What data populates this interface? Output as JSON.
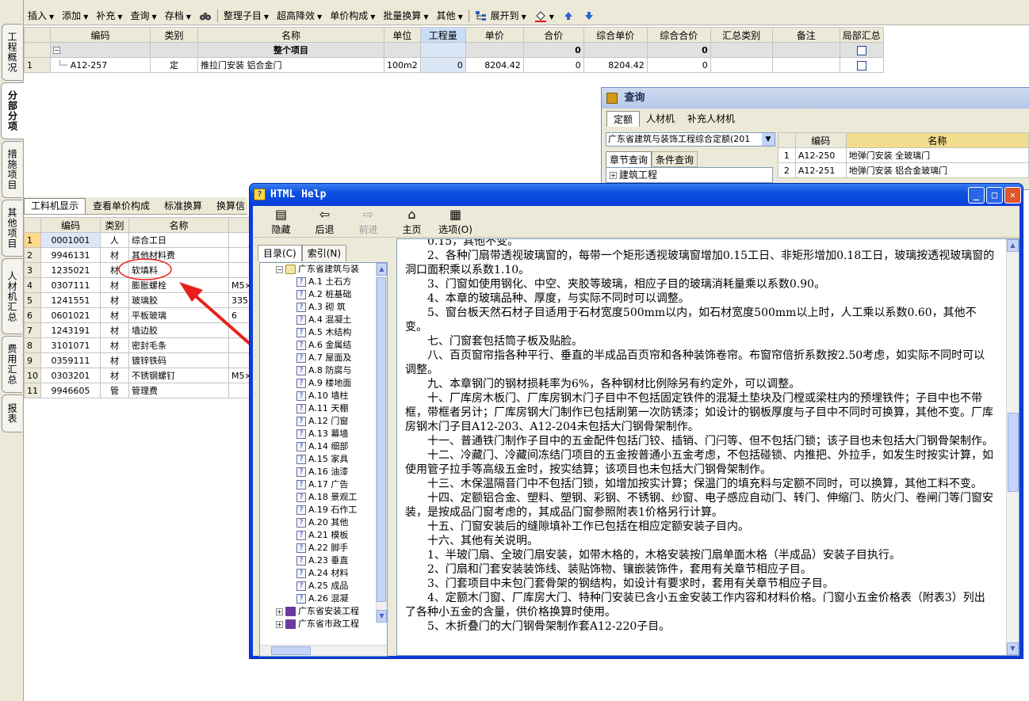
{
  "side_tabs": [
    {
      "label": "工程概况",
      "active": false
    },
    {
      "label": "分部分项",
      "active": true
    },
    {
      "label": "措施项目",
      "active": false
    },
    {
      "label": "其他项目",
      "active": false
    },
    {
      "label": "人材机汇总",
      "active": false
    },
    {
      "label": "费用汇总",
      "active": false
    },
    {
      "label": "报表",
      "active": false
    }
  ],
  "toolbar": {
    "insert": "插入",
    "add": "添加",
    "supplement": "补充",
    "query": "查询",
    "archive": "存档",
    "organize": "整理子目",
    "superheight": "超高降效",
    "unit_price": "单价构成",
    "batch": "批量换算",
    "other": "其他",
    "expand": "展开到"
  },
  "main_table": {
    "headers": [
      "编码",
      "类别",
      "名称",
      "单位",
      "工程量",
      "单价",
      "合价",
      "综合单价",
      "综合合价",
      "汇总类别",
      "备注",
      "局部汇总"
    ],
    "total_row": {
      "name": "整个项目",
      "hejia": "0",
      "zonghe_hejia": "0"
    },
    "rows": [
      {
        "num": "1",
        "code": "A12-257",
        "type": "定",
        "name": "推拉门安装 铝合金门",
        "unit": "100m2",
        "qty": "0",
        "price": "8204.42",
        "hejia": "0",
        "zonghe_price": "8204.42",
        "zonghe_hejia": "0"
      }
    ]
  },
  "lower_tabs": [
    "工料机显示",
    "查看单价构成",
    "标准换算",
    "换算信"
  ],
  "materials": {
    "headers": [
      "编码",
      "类别",
      "名称"
    ],
    "rows": [
      {
        "num": "1",
        "code": "0001001",
        "type": "人",
        "name": "综合工日",
        "extra": ""
      },
      {
        "num": "2",
        "code": "9946131",
        "type": "材",
        "name": "其他材料费",
        "extra": ""
      },
      {
        "num": "3",
        "code": "1235021",
        "type": "材",
        "name": "软填料",
        "extra": ""
      },
      {
        "num": "4",
        "code": "0307111",
        "type": "材",
        "name": "膨胀螺栓",
        "extra": "M5×"
      },
      {
        "num": "5",
        "code": "1241551",
        "type": "材",
        "name": "玻璃胶",
        "extra": "335"
      },
      {
        "num": "6",
        "code": "0601021",
        "type": "材",
        "name": "平板玻璃",
        "extra": "6"
      },
      {
        "num": "7",
        "code": "1243191",
        "type": "材",
        "name": "墙边胶",
        "extra": ""
      },
      {
        "num": "8",
        "code": "3101071",
        "type": "材",
        "name": "密封毛条",
        "extra": ""
      },
      {
        "num": "9",
        "code": "0359111",
        "type": "材",
        "name": "镀锌铁码",
        "extra": ""
      },
      {
        "num": "10",
        "code": "0303201",
        "type": "材",
        "name": "不锈钢螺钉",
        "extra": "M5×"
      },
      {
        "num": "11",
        "code": "9946605",
        "type": "管",
        "name": "管理费",
        "extra": ""
      }
    ]
  },
  "query_window": {
    "title": "查询",
    "tabs": [
      "定额",
      "人材机",
      "补充人材机"
    ],
    "select": "广东省建筑与装饰工程综合定额(201",
    "subtabs": [
      "章节查询",
      "条件查询"
    ],
    "tree_item": "建筑工程",
    "headers": [
      "编码",
      "名称"
    ],
    "rows": [
      {
        "num": "1",
        "code": "A12-250",
        "name": "地弹门安装 全玻璃门"
      },
      {
        "num": "2",
        "code": "A12-251",
        "name": "地弹门安装 铝合金玻璃门"
      }
    ]
  },
  "help_window": {
    "title": "HTML Help",
    "buttons": {
      "hide": "隐藏",
      "back": "后退",
      "forward": "前进",
      "home": "主页",
      "options": "选项(O)"
    },
    "nav_tabs": [
      "目录(C)",
      "索引(N)"
    ],
    "tree_root": "广东省建筑与装",
    "tree_items": [
      "A.1 土石方",
      "A.2 桩基础",
      "A.3 砌 筑",
      "A.4 混凝土",
      "A.5 木结构",
      "A.6 金属结",
      "A.7 屋面及",
      "A.8 防腐与",
      "A.9 楼地面",
      "A.10 墙柱",
      "A.11 天棚",
      "A.12 门窗",
      "A.13 幕墙",
      "A.14 细部",
      "A.15 家具",
      "A.16 油漆",
      "A.17 广告",
      "A.18 景观工",
      "A.19 石作工",
      "A.20 其他",
      "A.21 模板",
      "A.22 脚手",
      "A.23 垂直",
      "A.24 材料",
      "A.25 成品",
      "A.26 混凝"
    ],
    "tree_bottom": [
      "广东省安装工程",
      "广东省市政工程"
    ],
    "paragraphs": [
      "0.15，其他不变。",
      "2、各种门扇带透视玻璃窗的，每带一个矩形透视玻璃窗增加0.15工日、非矩形增加0.18工日，玻璃按透视玻璃窗的洞口面积乘以系数1.10。",
      "3、门窗如使用钢化、中空、夹胶等玻璃，相应子目的玻璃消耗量乘以系数0.90。",
      "4、本章的玻璃品种、厚度，与实际不同时可以调整。",
      "5、窗台板天然石材子目适用于石材宽度500mm以内，如石材宽度500mm以上时，人工乘以系数0.60，其他不变。",
      "七、门窗套包括筒子板及贴脸。",
      "八、百页窗帘指各种平行、垂直的半成品百页帘和各种装饰卷帘。布窗帘倍折系数按2.50考虑，如实际不同时可以调整。",
      "九、本章钢门的钢材损耗率为6%，各种钢材比例除另有约定外，可以调整。",
      "十、厂库房木板门、厂库房钢木门子目中不包括固定铁件的混凝土垫块及门樘或梁柱内的预埋铁件；子目中也不带框，带框者另计；厂库房钢大门制作已包括刷第一次防锈漆；如设计的钢板厚度与子目中不同时可换算，其他不变。厂库房钢木门子目A12-203、A12-204未包括大门钢骨架制作。",
      "十一、普通铁门制作子目中的五金配件包括门铰、插销、门闩等、但不包括门锁；该子目也未包括大门钢骨架制作。",
      "十二、冷藏门、冷藏间冻结门项目的五金按普通小五金考虑，不包括碰锁、内推把、外拉手，如发生时按实计算，如使用管子拉手等高级五金时，按实结算；该项目也未包括大门钢骨架制作。",
      "十三、木保温隔音门中不包括门锁，如增加按实计算；保温门的填充料与定额不同时，可以换算，其他工料不变。",
      "十四、定额铝合金、塑料、塑钢、彩钢、不锈钢、纱窗、电子感应自动门、转门、伸缩门、防火门、卷闸门等门窗安装，是按成品门窗考虑的，其成品门窗参照附表1价格另行计算。",
      "十五、门窗安装后的缝隙填补工作已包括在相应定额安装子目内。",
      "十六、其他有关说明。",
      "1、半玻门扇、全玻门扇安装，如带木格的，木格安装按门扇单面木格（半成品）安装子目执行。",
      "2、门扇和门套安装装饰线、装贴饰物、镶嵌装饰件，套用有关章节相应子目。",
      "3、门套项目中未包门套骨架的钢结构，如设计有要求时，套用有关章节相应子目。",
      "4、定额木门窗、厂库房大门、特种门安装已含小五金安装工作内容和材料价格。门窗小五金价格表（附表3）列出了各种小五金的含量，供价格换算时使用。",
      "5、木折叠门的大门钢骨架制作套A12-220子目。"
    ]
  }
}
